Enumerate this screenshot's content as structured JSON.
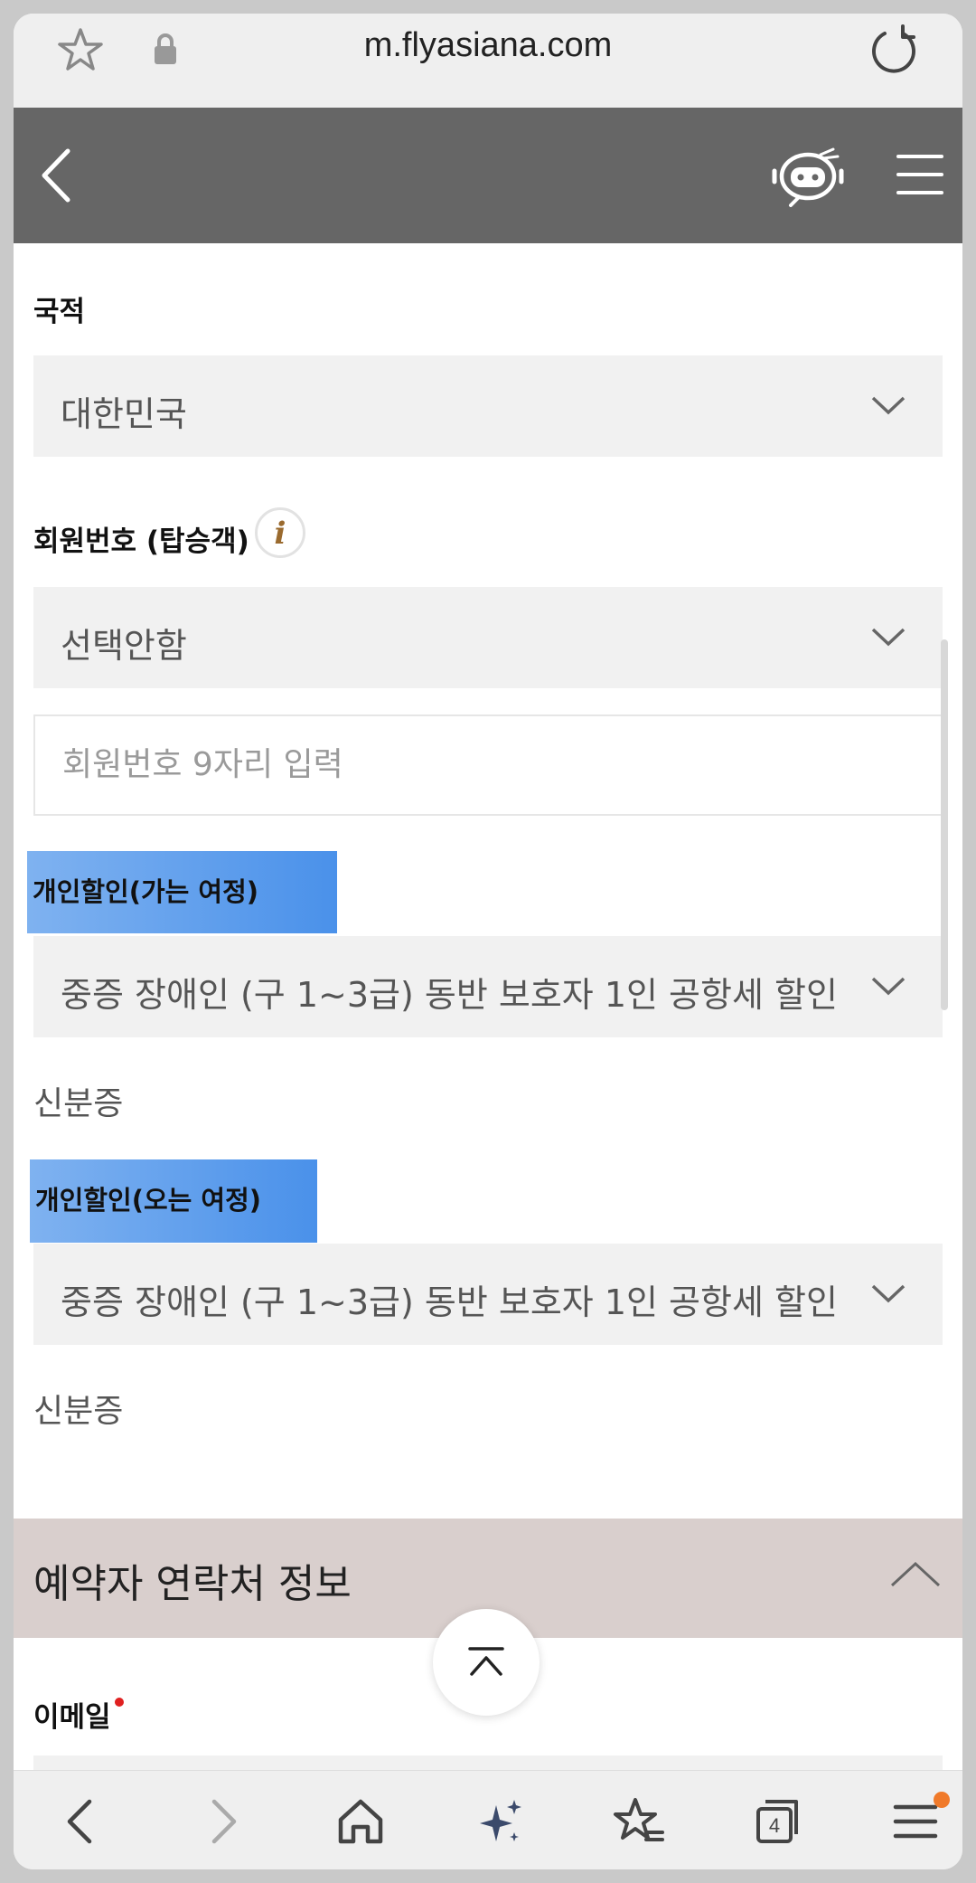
{
  "browser": {
    "url": "m.flyasiana.com",
    "tab_count": "4"
  },
  "form": {
    "nationality": {
      "label": "국적",
      "value": "대한민국"
    },
    "member_number": {
      "label": "회원번호 (탑승객)",
      "info_icon": "i",
      "select_value": "선택안함",
      "input_placeholder": "회원번호 9자리 입력"
    },
    "discount_outbound": {
      "label": "개인할인(가는 여정)",
      "value": "중증 장애인 (구 1~3급) 동반 보호자 1인 공항세 할인",
      "note": "신분증"
    },
    "discount_return": {
      "label": "개인할인(오는 여정)",
      "value": "중증 장애인 (구 1~3급) 동반 보호자 1인 공항세 할인",
      "note": "신분증"
    }
  },
  "booker_section": {
    "title": "예약자 연락처 정보",
    "email_label": "이메일"
  },
  "colors": {
    "header": "#666666",
    "highlight": "#4a91ea",
    "section_bg": "#d9cfcd",
    "required_dot": "#e02020"
  }
}
